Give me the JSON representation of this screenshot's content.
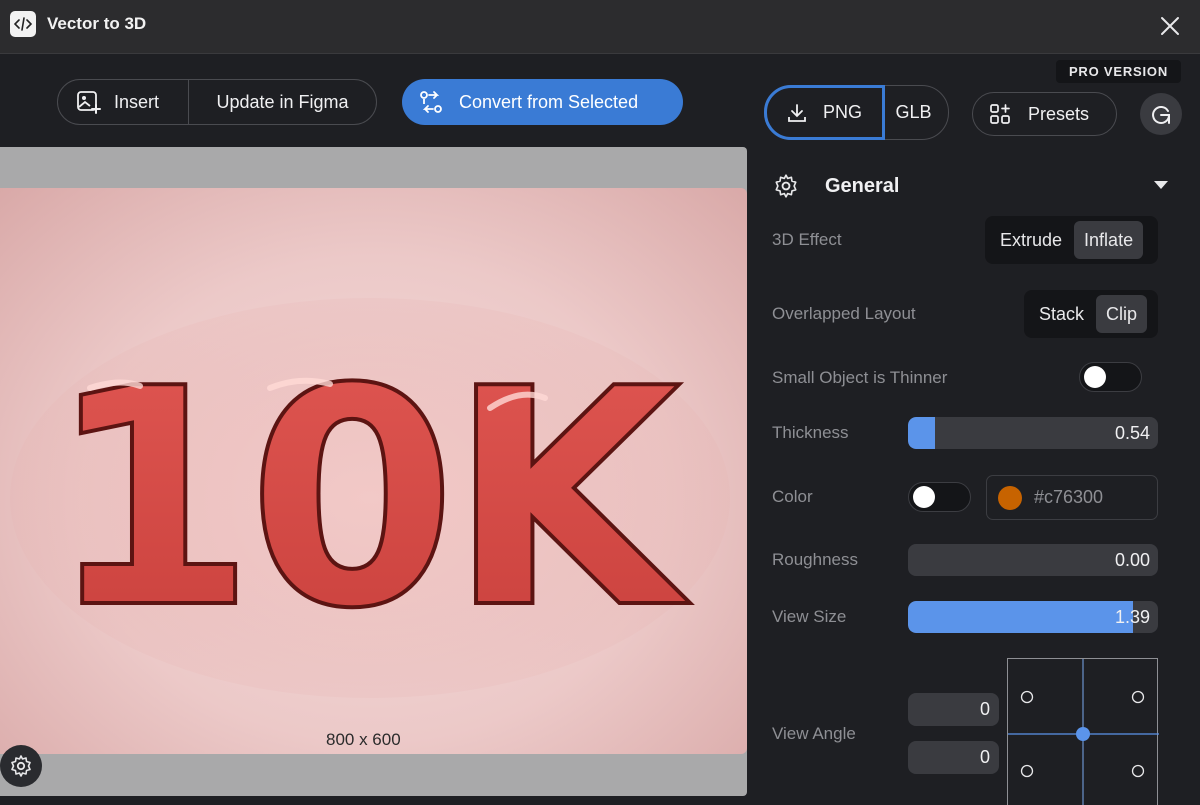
{
  "window": {
    "title": "Vector to 3D"
  },
  "toolbar": {
    "insert_label": "Insert",
    "update_label": "Update in Figma",
    "convert_label": "Convert from Selected",
    "pro_badge": "PRO VERSION",
    "export_png_label": "PNG",
    "export_glb_label": "GLB",
    "presets_label": "Presets"
  },
  "canvas": {
    "text": "10K",
    "size_label": "800 x 600"
  },
  "panel": {
    "section_title": "General",
    "effect": {
      "label": "3D Effect",
      "options": [
        "Extrude",
        "Inflate"
      ],
      "selected": "Inflate"
    },
    "layout": {
      "label": "Overlapped Layout",
      "options": [
        "Stack",
        "Clip"
      ],
      "selected": "Clip"
    },
    "small_thinner": {
      "label": "Small Object is Thinner",
      "on": false
    },
    "thickness": {
      "label": "Thickness",
      "value": "0.54"
    },
    "color": {
      "label": "Color",
      "toggle_on": false,
      "hex": "#c76300"
    },
    "roughness": {
      "label": "Roughness",
      "value": "0.00"
    },
    "view_size": {
      "label": "View Size",
      "value": "1.39"
    },
    "view_angle": {
      "label": "View Angle",
      "x": "0",
      "y": "0"
    }
  },
  "colors": {
    "accent": "#3a7bd5",
    "slider_fill": "#5b94ea",
    "swatch": "#c76300"
  }
}
